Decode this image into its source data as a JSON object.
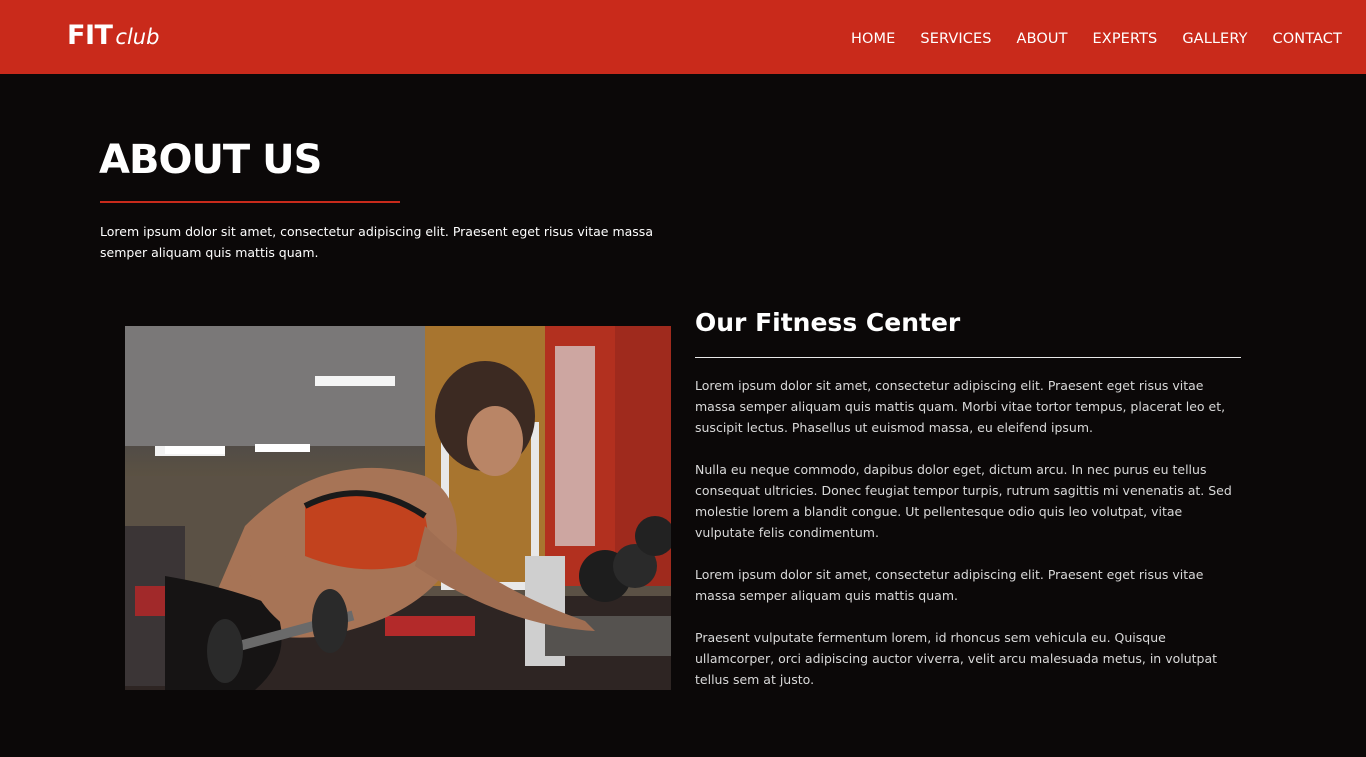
{
  "brand": {
    "logo_bold": "FIT",
    "logo_italic": "club",
    "color": "#c92a1b"
  },
  "nav": {
    "items": [
      {
        "label": "HOME"
      },
      {
        "label": "SERVICES"
      },
      {
        "label": "ABOUT"
      },
      {
        "label": "EXPERTS"
      },
      {
        "label": "GALLERY"
      },
      {
        "label": "CONTACT"
      }
    ]
  },
  "about": {
    "title": "ABOUT US",
    "intro": "Lorem ipsum dolor sit amet, consectetur adipiscing elit. Praesent eget risus vitae massa semper aliquam quis mattis quam."
  },
  "center": {
    "title": "Our Fitness Center",
    "paragraphs": [
      "Lorem ipsum dolor sit amet, consectetur adipiscing elit. Praesent eget risus vitae massa semper aliquam quis mattis quam. Morbi vitae tortor tempus, placerat leo et, suscipit lectus. Phasellus ut euismod massa, eu eleifend ipsum.",
      "Nulla eu neque commodo, dapibus dolor eget, dictum arcu. In nec purus eu tellus consequat ultricies. Donec feugiat tempor turpis, rutrum sagittis mi venenatis at. Sed molestie lorem a blandit congue. Ut pellentesque odio quis leo volutpat, vitae vulputate felis condimentum.",
      "Lorem ipsum dolor sit amet, consectetur adipiscing elit. Praesent eget risus vitae massa semper aliquam quis mattis quam.",
      "Praesent vulputate fermentum lorem, id rhoncus sem vehicula eu. Quisque ullamcorper, orci adipiscing auctor viverra, velit arcu malesuada metus, in volutpat tellus sem at justo."
    ]
  }
}
